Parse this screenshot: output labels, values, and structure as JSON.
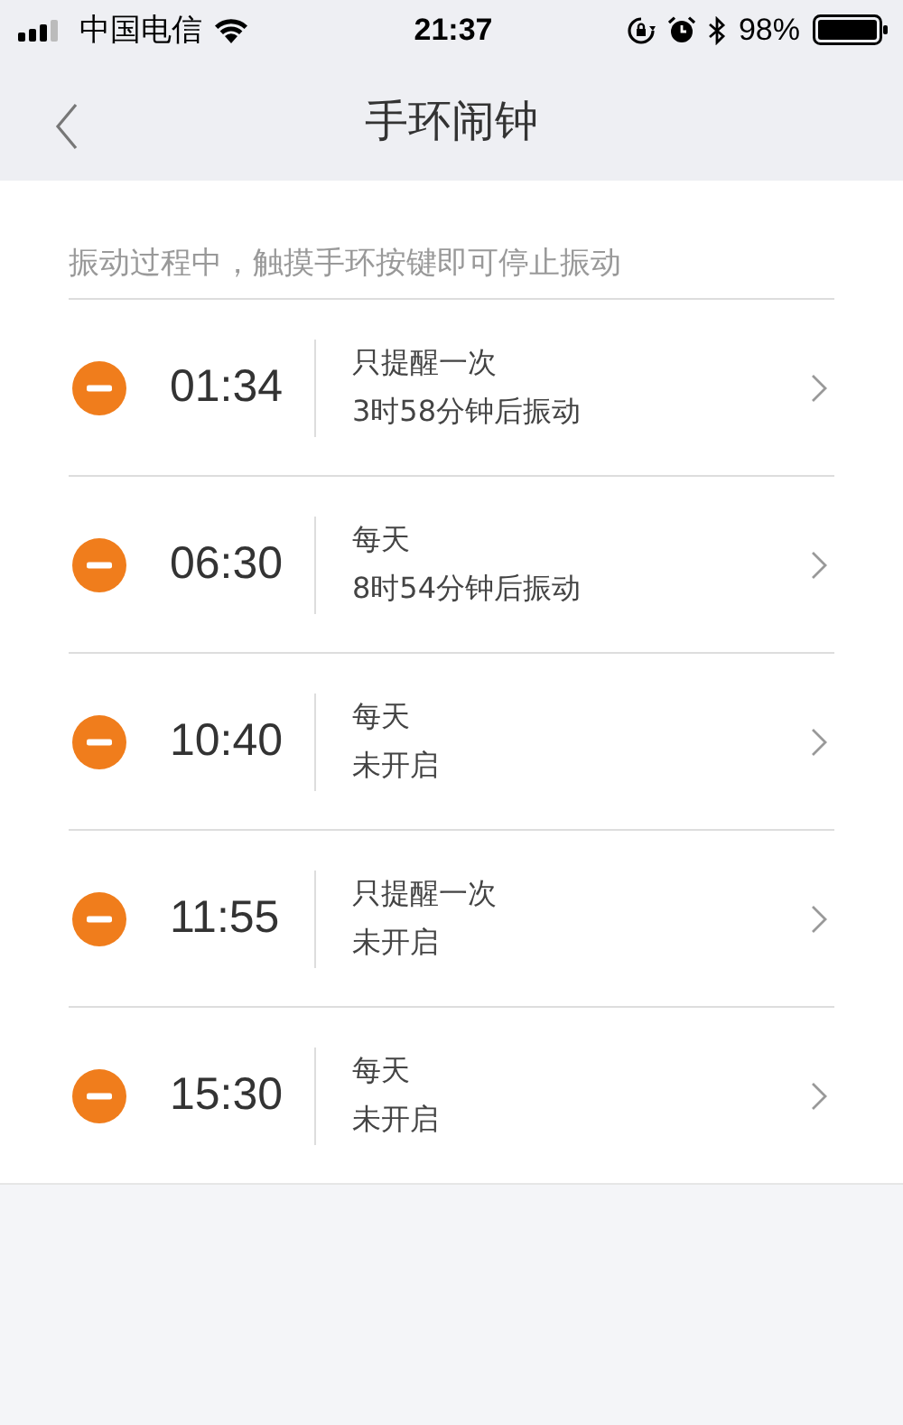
{
  "status_bar": {
    "carrier": "中国电信",
    "time": "21:37",
    "battery": "98%"
  },
  "nav": {
    "title": "手环闹钟"
  },
  "hint": "振动过程中，触摸手环按键即可停止振动",
  "alarms": [
    {
      "time": "01:34",
      "repeat": "只提醒一次",
      "status": "3时58分钟后振动"
    },
    {
      "time": "06:30",
      "repeat": "每天",
      "status": "8时54分钟后振动"
    },
    {
      "time": "10:40",
      "repeat": "每天",
      "status": "未开启"
    },
    {
      "time": "11:55",
      "repeat": "只提醒一次",
      "status": "未开启"
    },
    {
      "time": "15:30",
      "repeat": "每天",
      "status": "未开启"
    }
  ]
}
